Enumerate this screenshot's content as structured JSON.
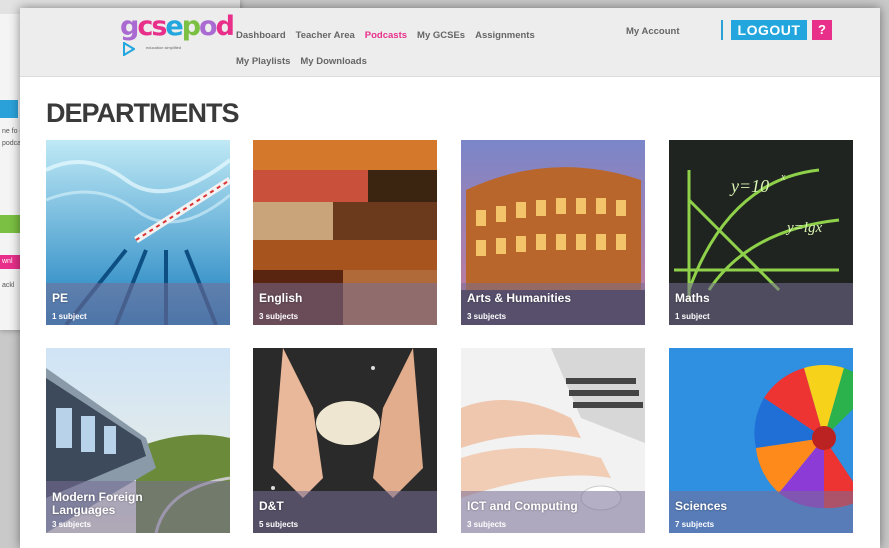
{
  "background_window": {
    "snippets": [
      "ne fo d",
      "podca",
      "wnl",
      "ackl"
    ]
  },
  "header": {
    "logo": {
      "text": "gcsepod",
      "tagline": "education simplified",
      "colors": [
        "#a96bd1",
        "#e8308b",
        "#22a6dd",
        "#7bc043"
      ]
    },
    "nav": [
      {
        "label": "Dashboard",
        "active": false
      },
      {
        "label": "Teacher Area",
        "active": false
      },
      {
        "label": "Podcasts",
        "active": true
      },
      {
        "label": "My GCSEs",
        "active": false
      },
      {
        "label": "Assignments",
        "active": false
      },
      {
        "label": "My Playlists",
        "active": false
      },
      {
        "label": "My Downloads",
        "active": false
      }
    ],
    "account_label": "My Account",
    "logout_label": "LOGOUT",
    "help_label": "?"
  },
  "page_title": "DEPARTMENTS",
  "departments": [
    {
      "name": "PE",
      "count": "1 subject"
    },
    {
      "name": "English",
      "count": "3 subjects"
    },
    {
      "name": "Arts & Humanities",
      "count": "3 subjects"
    },
    {
      "name": "Maths",
      "count": "1 subject"
    },
    {
      "name": "Modern Foreign Languages",
      "count": "3 subjects"
    },
    {
      "name": "D&T",
      "count": "5 subjects"
    },
    {
      "name": "ICT and Computing",
      "count": "3 subjects"
    },
    {
      "name": "Sciences",
      "count": "7 subjects"
    }
  ],
  "colors": {
    "accent_pink": "#e8308b",
    "accent_blue": "#22a6dd",
    "title": "#3a3a3a"
  }
}
